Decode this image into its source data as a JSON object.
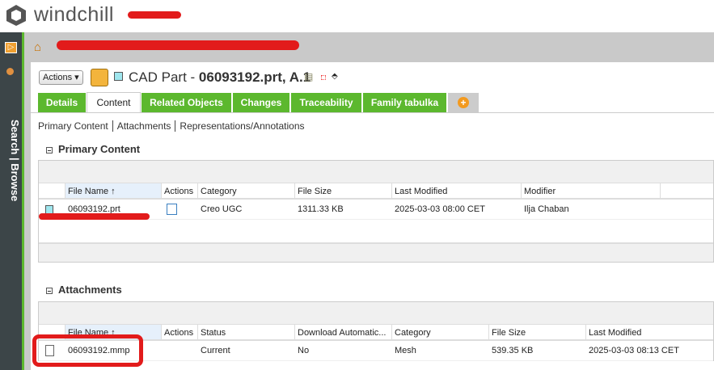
{
  "app": {
    "logo_text": "windchill"
  },
  "sidebar": {
    "label": "Search | Browse"
  },
  "header": {
    "actions_label": "Actions ▾",
    "title_prefix": "CAD Part - ",
    "title_name": "06093192.prt, A.1"
  },
  "tabs": [
    {
      "label": "Details"
    },
    {
      "label": "Content",
      "active": true
    },
    {
      "label": "Related Objects"
    },
    {
      "label": "Changes"
    },
    {
      "label": "Traceability"
    },
    {
      "label": "Family tabulka"
    }
  ],
  "sublinks": [
    "Primary Content",
    "Attachments",
    "Representations/Annotations"
  ],
  "primary": {
    "heading": "Primary Content",
    "columns": [
      "File Name ↑",
      "Actions",
      "Category",
      "File Size",
      "Last Modified",
      "Modifier"
    ],
    "rows": [
      {
        "file": "06093192.prt",
        "category": "Creo UGC",
        "size": "1311.33 KB",
        "modified": "2025-03-03 08:00 CET",
        "modifier": "Ilja Chaban"
      }
    ]
  },
  "attachments": {
    "heading": "Attachments",
    "columns": [
      "File Name ↑",
      "Actions",
      "Status",
      "Download Automatic...",
      "Category",
      "File Size",
      "Last Modified"
    ],
    "rows": [
      {
        "file": "06093192.mmp",
        "status": "Current",
        "download": "No",
        "category": "Mesh",
        "size": "539.35 KB",
        "modified": "2025-03-03 08:13 CET"
      }
    ]
  },
  "colors": {
    "tab_green": "#5cb82e",
    "sidebar": "#3c4548",
    "annotation_red": "#e21b1b"
  }
}
